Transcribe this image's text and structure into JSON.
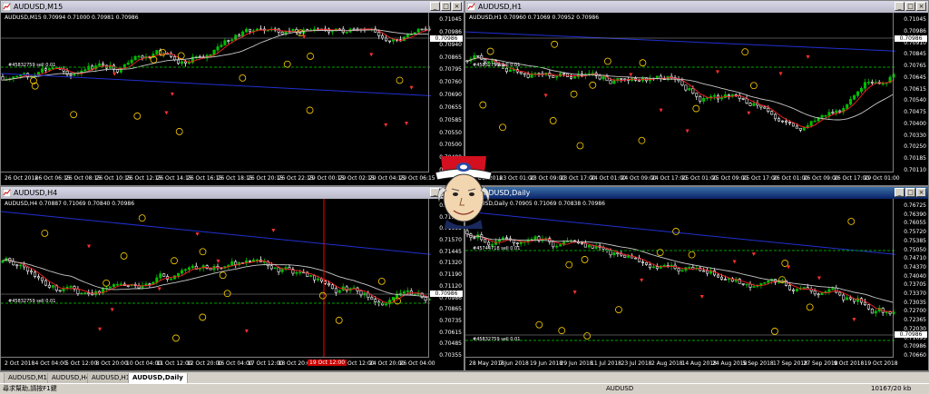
{
  "windows": [
    {
      "id": "m15",
      "title": "AUDUSD,M15",
      "info": "AUDUSD,M15  0.70994 0.71000 0.70981 0.70986",
      "order_label": "#45832759 sell 0.01",
      "yticks": [
        "0.71045",
        "0.70986",
        "0.70940",
        "0.70865",
        "0.70795",
        "0.70760",
        "0.70690",
        "0.70655",
        "0.70585",
        "0.70550",
        "0.70500",
        "0.70480",
        "0.70410"
      ],
      "xticks": [
        "26 Oct 2018",
        "26 Oct 06:15",
        "26 Oct 08:15",
        "26 Oct 10:15",
        "26 Oct 12:15",
        "26 Oct 14:15",
        "26 Oct 16:15",
        "26 Oct 18:15",
        "26 Oct 20:15",
        "26 Oct 22:15",
        "29 Oct 00:15",
        "29 Oct 02:15",
        "29 Oct 04:15",
        "29 Oct 06:15"
      ],
      "price": "0.70986",
      "active": false
    },
    {
      "id": "h1",
      "title": "AUDUSD,H1",
      "info": "AUDUSD,H1  0.70960 0.71069 0.70952 0.70986",
      "order_label": "#45832759 sell 0.01",
      "yticks": [
        "0.71045",
        "0.70986",
        "0.70910",
        "0.70845",
        "0.70765",
        "0.70645",
        "0.70615",
        "0.70540",
        "0.70475",
        "0.70400",
        "0.70330",
        "0.70250",
        "0.70185",
        "0.70110"
      ],
      "xticks": [
        "22 Oct 2018",
        "23 Oct 01:00",
        "23 Oct 09:00",
        "23 Oct 17:00",
        "24 Oct 01:00",
        "24 Oct 09:00",
        "24 Oct 17:00",
        "25 Oct 01:00",
        "25 Oct 09:00",
        "25 Oct 17:00",
        "26 Oct 01:00",
        "26 Oct 09:00",
        "26 Oct 17:00",
        "29 Oct 01:00"
      ],
      "price": "0.70986",
      "active": false
    },
    {
      "id": "h4",
      "title": "AUDUSD,H4",
      "info": "AUDUSD,H4  0.70887 0.71069 0.70840 0.70986",
      "order_label": "#45832759 sell 0.01",
      "yticks": [
        "0.71950",
        "0.71825",
        "0.71695",
        "0.71570",
        "0.71445",
        "0.71320",
        "0.71190",
        "0.71120",
        "0.70986",
        "0.70865",
        "0.70735",
        "0.70615",
        "0.70485",
        "0.70355"
      ],
      "xticks": [
        "2 Oct 2018",
        "4 Oct 04:00",
        "5 Oct 12:00",
        "8 Oct 20:00",
        "10 Oct 04:00",
        "11 Oct 12:00",
        "12 Oct 20:00",
        "16 Oct 04:00",
        "17 Oct 12:00",
        "18 Oct 20:00",
        "22 Oct 04:00",
        "23 Oct 12:00",
        "24 Oct 20:00",
        "26 Oct 04:00"
      ],
      "cursor_label": "19 Oct 12:00",
      "price": "0.70986",
      "active": false
    },
    {
      "id": "daily",
      "title": "AUDUSD,Daily",
      "info": "AUDUSD,Daily  0.70905 0.71069 0.70838 0.70986",
      "order_label_1": "#45744718 sell 0.01",
      "order_label_2": "#45832759 sell 0.01",
      "yticks": [
        "0.76725",
        "0.76390",
        "0.76055",
        "0.75720",
        "0.75385",
        "0.75050",
        "0.74710",
        "0.74370",
        "0.74040",
        "0.73705",
        "0.73370",
        "0.73035",
        "0.72700",
        "0.72365",
        "0.72030",
        "0.71695",
        "0.70986",
        "0.70660"
      ],
      "xticks": [
        "28 May 2018",
        "7 Jun 2018",
        "19 Jun 2018",
        "29 Jun 2018",
        "11 Jul 2018",
        "23 Jul 2018",
        "2 Aug 2018",
        "14 Aug 2018",
        "24 Aug 2018",
        "5 Sep 2018",
        "17 Sep 2018",
        "27 Sep 2018",
        "9 Oct 2018",
        "19 Oct 2018"
      ],
      "price": "0.70986",
      "active": true
    }
  ],
  "tabs": [
    "AUDUSD,M15",
    "AUDUSD,H4",
    "AUDUSD,H1",
    "AUDUSD,Daily"
  ],
  "active_tab": "AUDUSD,Daily",
  "status": {
    "help": "尋求幫助,請按F1鍵",
    "symbol": "AUDUSD",
    "traffic": "10167/20 kb"
  },
  "colors": {
    "bull": "#00c000",
    "bear": "#ffffff",
    "ma_fast": "#ff2020",
    "ma_slow": "#c8c8c8",
    "ma_long": "#2030d0",
    "order_line": "#00a000",
    "signal": "#ffd000",
    "arrow": "#ff3030"
  }
}
